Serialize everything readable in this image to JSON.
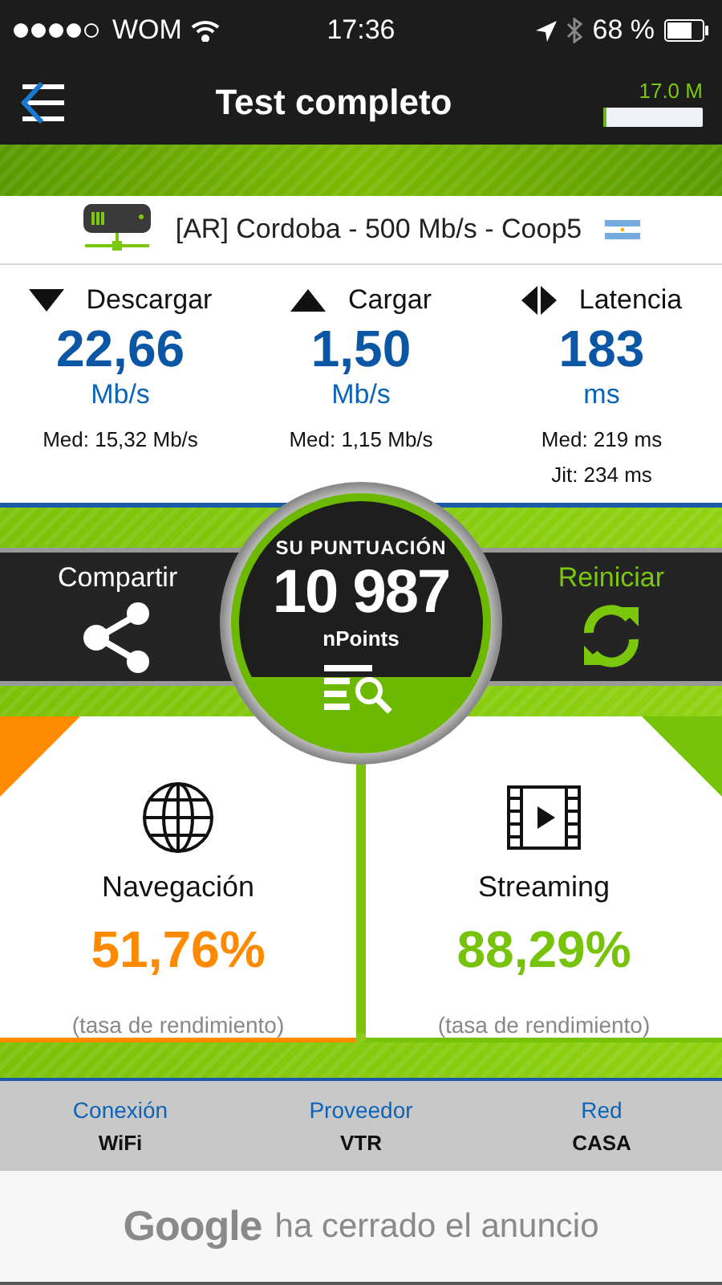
{
  "status_bar": {
    "carrier": "WOM",
    "time": "17:36",
    "battery": "68 %"
  },
  "header": {
    "title": "Test completo",
    "data_used": "17.0 M",
    "level": 0.03
  },
  "server": {
    "name": "[AR] Cordoba - 500 Mb/s - Coop5"
  },
  "metrics": [
    {
      "kind": "download",
      "label": "Descargar",
      "value": "22,66",
      "unit": "Mb/s",
      "details": [
        "Med: 15,32 Mb/s"
      ]
    },
    {
      "kind": "upload",
      "label": "Cargar",
      "value": "1,50",
      "unit": "Mb/s",
      "details": [
        "Med: 1,15 Mb/s"
      ]
    },
    {
      "kind": "latency",
      "label": "Latencia",
      "value": "183",
      "unit": "ms",
      "details": [
        "Med: 219 ms",
        "Jit: 234 ms"
      ]
    }
  ],
  "score": {
    "share": "Compartir",
    "heading": "SU PUNTUACIÓN",
    "value": "10 987",
    "unit": "nPoints",
    "restart": "Reiniciar"
  },
  "cards": [
    {
      "kind": "browsing",
      "title": "Navegación",
      "value": "51,76%",
      "note": "(tasa de rendimiento)",
      "color": "#ff8a00"
    },
    {
      "kind": "streaming",
      "title": "Streaming",
      "value": "88,29%",
      "note": "(tasa de rendimiento)",
      "color": "#77c20a"
    }
  ],
  "info": [
    {
      "label": "Conexión",
      "value": "WiFi"
    },
    {
      "label": "Proveedor",
      "value": "VTR"
    },
    {
      "label": "Red",
      "value": "CASA"
    }
  ],
  "ad": {
    "brand": "Google",
    "text": "ha cerrado el anuncio"
  }
}
